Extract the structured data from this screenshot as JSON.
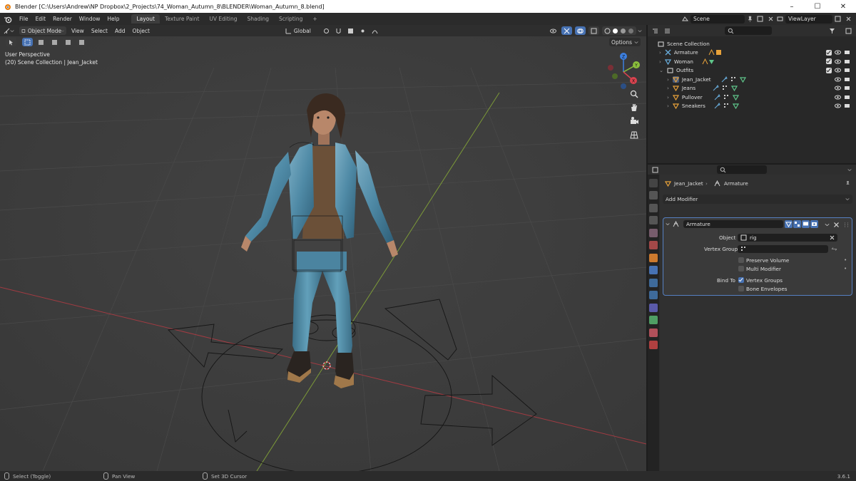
{
  "window": {
    "title": "Blender [C:\\Users\\Andrew\\NP Dropbox\\2_Projects\\74_Woman_Autumn_8\\BLENDER\\Woman_Autumn_8.blend]",
    "minimize": "–",
    "maximize": "☐",
    "close": "✕"
  },
  "menubar": {
    "items": [
      "File",
      "Edit",
      "Render",
      "Window",
      "Help"
    ],
    "workspaces": [
      "Layout",
      "Texture Paint",
      "UV Editing",
      "Shading",
      "Scripting"
    ],
    "add_workspace": "+",
    "scene": "Scene",
    "view_layer": "ViewLayer"
  },
  "viewport": {
    "mode": "Object Mode",
    "menus": [
      "View",
      "Select",
      "Add",
      "Object"
    ],
    "transform_orientation": "Global",
    "perspective": "User Perspective",
    "collection_info": "(20) Scene Collection | Jean_Jacket",
    "options": "Options",
    "gizmo": {
      "x": "X",
      "y": "Y",
      "z": "Z"
    }
  },
  "outliner": {
    "root": "Scene Collection",
    "rows": [
      {
        "name": "Armature",
        "indent": 1
      },
      {
        "name": "Woman",
        "indent": 1
      },
      {
        "name": "Outfits",
        "indent": 1
      },
      {
        "name": "Jean_Jacket",
        "indent": 2
      },
      {
        "name": "Jeans",
        "indent": 2
      },
      {
        "name": "Pullover",
        "indent": 2
      },
      {
        "name": "Sneakers",
        "indent": 2
      }
    ]
  },
  "properties": {
    "breadcrumb_object": "Jean_Jacket",
    "breadcrumb_sep": "›",
    "breadcrumb_modifier": "Armature",
    "add_modifier": "Add Modifier",
    "modifier_name": "Armature",
    "object_label": "Object",
    "object_value": "rig",
    "vertex_group_label": "Vertex Group",
    "preserve_volume": "Preserve Volume",
    "multi_modifier": "Multi Modifier",
    "bind_to_label": "Bind To",
    "vertex_groups": "Vertex Groups",
    "bone_envelopes": "Bone Envelopes",
    "checked": {
      "preserve_volume": false,
      "multi_modifier": false,
      "vertex_groups": true,
      "bone_envelopes": false
    }
  },
  "statusbar": {
    "select": "Select (Toggle)",
    "pan": "Pan View",
    "cursor": "Set 3D Cursor",
    "version": "3.6.1"
  },
  "colors": {
    "accent": "#4772b3",
    "x_axis": "#d9434f",
    "y_axis": "#8bbf3c",
    "z_axis": "#3c7fe0"
  }
}
